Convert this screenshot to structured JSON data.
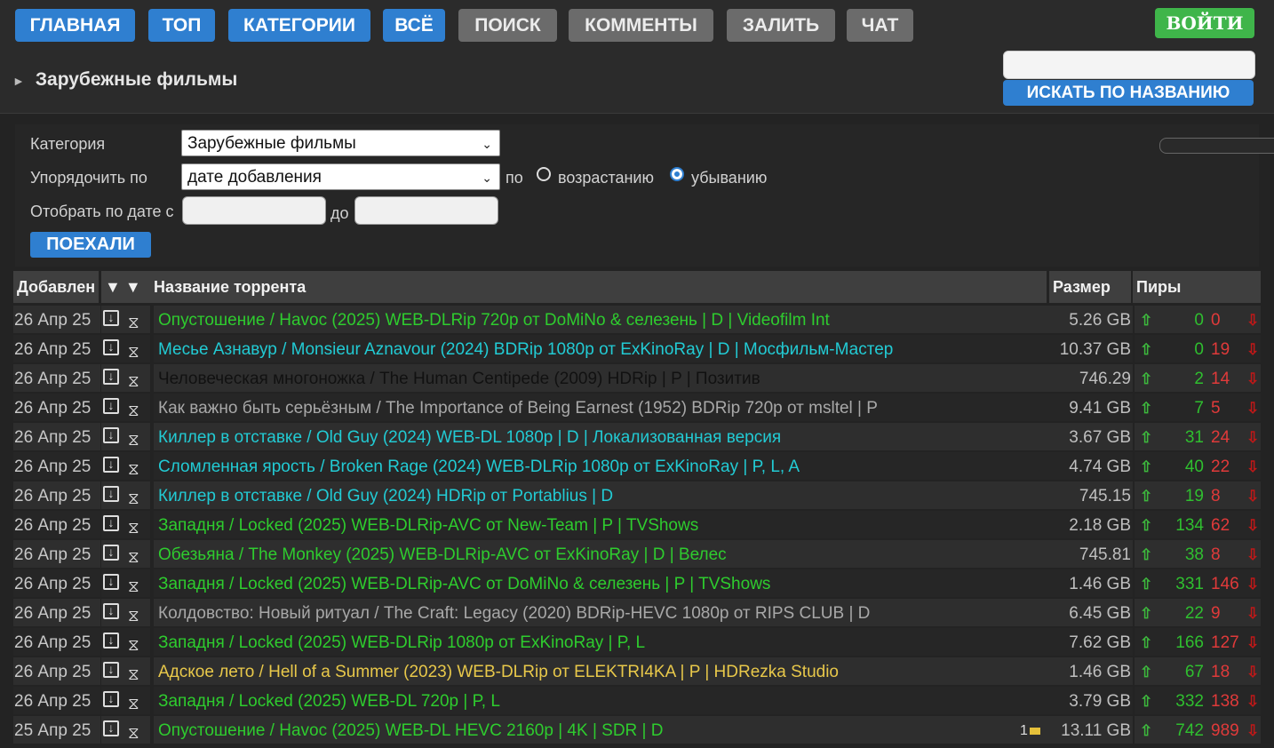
{
  "nav": {
    "items": [
      {
        "label": "ГЛАВНАЯ",
        "style": "blue"
      },
      {
        "label": "ТОП",
        "style": "blue"
      },
      {
        "label": "КАТЕГОРИИ",
        "style": "blue"
      },
      {
        "label": "ВСЁ",
        "style": "blue"
      },
      {
        "label": "ПОИСК",
        "style": "gray"
      },
      {
        "label": "КОММЕНТЫ",
        "style": "gray"
      },
      {
        "label": "ЗАЛИТЬ",
        "style": "gray"
      },
      {
        "label": "ЧАТ",
        "style": "gray"
      }
    ],
    "login_label": "ВОЙТИ"
  },
  "search": {
    "placeholder": "",
    "button_label": "ИСКАТЬ ПО НАЗВАНИЮ"
  },
  "page_title": "Зарубежные фильмы",
  "filters": {
    "category_label": "Категория",
    "category_value": "Зарубежные фильмы",
    "sort_label": "Упорядочить по",
    "sort_value": "дате добавления",
    "by_label": "по",
    "asc_label": "возрастанию",
    "desc_label": "убыванию",
    "order_selected": "desc",
    "date_label": "Отобрать по дате с",
    "to_label": "до",
    "go_label": "ПОЕХАЛИ"
  },
  "table": {
    "headers": {
      "added": "Добавлен",
      "sort_arrows": "▼ ▼",
      "name": "Название торрента",
      "size": "Размер",
      "peers": "Пиры"
    },
    "rows": [
      {
        "date": "26 Апр 25",
        "title": "Опустошение / Havoc (2025) WEB-DLRip 720p от DoMiNo & селезень | D | Videofilm Int",
        "color": "#2ecc2e",
        "size": "5.26 GB",
        "seeds": "0",
        "leech": "0",
        "comments": ""
      },
      {
        "date": "26 Апр 25",
        "title": "Месье Азнавур / Monsieur Aznavour (2024) BDRip 1080p от ExKinoRay | D | Мосфильм-Мастер",
        "color": "#22cbd4",
        "size": "10.37 GB",
        "seeds": "0",
        "leech": "19",
        "comments": ""
      },
      {
        "date": "26 Апр 25",
        "title": "Человеческая многоножка / The Human Centipede (2009) HDRip | P | Позитив",
        "color": "#111111",
        "size": "746.29 MB",
        "seeds": "2",
        "leech": "14",
        "comments": ""
      },
      {
        "date": "26 Апр 25",
        "title": "Как важно быть серьёзным / The Importance of Being Earnest (1952) BDRip 720p от msltel | P",
        "color": "#a8a8a8",
        "size": "9.41 GB",
        "seeds": "7",
        "leech": "5",
        "comments": ""
      },
      {
        "date": "26 Апр 25",
        "title": "Киллер в отставке / Old Guy (2024) WEB-DL 1080p | D | Локализованная версия",
        "color": "#22cbd4",
        "size": "3.67 GB",
        "seeds": "31",
        "leech": "24",
        "comments": ""
      },
      {
        "date": "26 Апр 25",
        "title": "Сломленная ярость / Broken Rage (2024) WEB-DLRip 1080p от ExKinoRay | P, L, A",
        "color": "#22cbd4",
        "size": "4.74 GB",
        "seeds": "40",
        "leech": "22",
        "comments": ""
      },
      {
        "date": "26 Апр 25",
        "title": "Киллер в отставке / Old Guy (2024) HDRip от Portablius | D",
        "color": "#22cbd4",
        "size": "745.15 MB",
        "seeds": "19",
        "leech": "8",
        "comments": ""
      },
      {
        "date": "26 Апр 25",
        "title": "Западня / Locked (2025) WEB-DLRip-AVC от New-Team | P | TVShows",
        "color": "#2ecc2e",
        "size": "2.18 GB",
        "seeds": "134",
        "leech": "62",
        "comments": ""
      },
      {
        "date": "26 Апр 25",
        "title": "Обезьяна / The Monkey (2025) WEB-DLRip-AVC от ExKinoRay | D | Велес",
        "color": "#2ecc2e",
        "size": "745.81 MB",
        "seeds": "38",
        "leech": "8",
        "comments": ""
      },
      {
        "date": "26 Апр 25",
        "title": "Западня / Locked (2025) WEB-DLRip-AVC от DoMiNo & селезень | P | TVShows",
        "color": "#2ecc2e",
        "size": "1.46 GB",
        "seeds": "331",
        "leech": "146",
        "comments": ""
      },
      {
        "date": "26 Апр 25",
        "title": "Колдовство: Новый ритуал / The Craft: Legacy (2020) BDRip-HEVC 1080p от RIPS CLUB | D",
        "color": "#a8a8a8",
        "size": "6.45 GB",
        "seeds": "22",
        "leech": "9",
        "comments": ""
      },
      {
        "date": "26 Апр 25",
        "title": "Западня / Locked (2025) WEB-DLRip 1080p от ExKinoRay | P, L",
        "color": "#2ecc2e",
        "size": "7.62 GB",
        "seeds": "166",
        "leech": "127",
        "comments": ""
      },
      {
        "date": "26 Апр 25",
        "title": "Адское лето / Hell of a Summer (2023) WEB-DLRip от ELEKTRI4KA | P | HDRezka Studio",
        "color": "#e8c84a",
        "size": "1.46 GB",
        "seeds": "67",
        "leech": "18",
        "comments": ""
      },
      {
        "date": "26 Апр 25",
        "title": "Западня / Locked (2025) WEB-DL 720p | P, L",
        "color": "#2ecc2e",
        "size": "3.79 GB",
        "seeds": "332",
        "leech": "138",
        "comments": ""
      },
      {
        "date": "25 Апр 25",
        "title": "Опустошение / Havoc (2025) WEB-DL HEVC 2160p | 4K | SDR | D",
        "color": "#2ecc2e",
        "size": "13.11 GB",
        "seeds": "742",
        "leech": "989",
        "comments": "1"
      }
    ]
  }
}
